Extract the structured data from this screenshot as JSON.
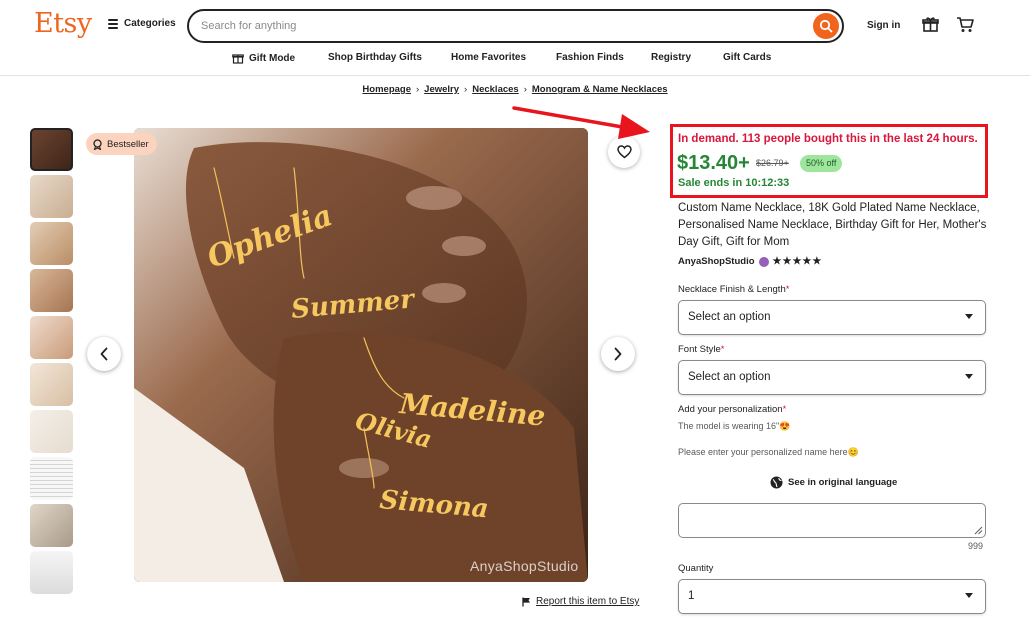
{
  "header": {
    "logo": "Etsy",
    "categories_label": "Categories",
    "search_placeholder": "Search for anything",
    "signin_label": "Sign in",
    "brand_color": "#f1641e"
  },
  "nav": {
    "items": [
      {
        "label": "Gift Mode",
        "icon": "gift-icon"
      },
      {
        "label": "Shop Birthday Gifts"
      },
      {
        "label": "Home Favorites"
      },
      {
        "label": "Fashion Finds"
      },
      {
        "label": "Registry"
      },
      {
        "label": "Gift Cards"
      }
    ]
  },
  "breadcrumb": [
    "Homepage",
    "Jewelry",
    "Necklaces",
    "Monogram & Name Necklaces"
  ],
  "gallery": {
    "badge": "Bestseller",
    "watermark": "AnyaShopStudio",
    "report_label": "Report this item to Etsy"
  },
  "product": {
    "demand_text": "In demand. 113 people bought this in the last 24 hours.",
    "price": "$13.40+",
    "original_price": "$26.79+",
    "discount": "50% off",
    "sale_ends": "Sale ends in 10:12:33",
    "title": "Custom Name Necklace, 18K Gold Plated Name Necklace, Personalised Name Necklace, Birthday Gift for Her, Mother's Day Gift, Gift for Mom",
    "shop_name": "AnyaShopStudio",
    "stars": "★★★★★",
    "price_color": "#258635",
    "demand_color": "#d9163c"
  },
  "options": {
    "finish_label": "Necklace Finish & Length",
    "finish_value": "Select an option",
    "font_label": "Font Style",
    "font_value": "Select an option",
    "required_mark": "*",
    "personalization_label": "Add your personalization",
    "model_note": "The model is wearing 16\"😍",
    "personalization_prompt": "Please enter your personalized name here😊",
    "see_original": "See in original language",
    "char_count": "999",
    "quantity_label": "Quantity",
    "quantity_value": "1"
  }
}
